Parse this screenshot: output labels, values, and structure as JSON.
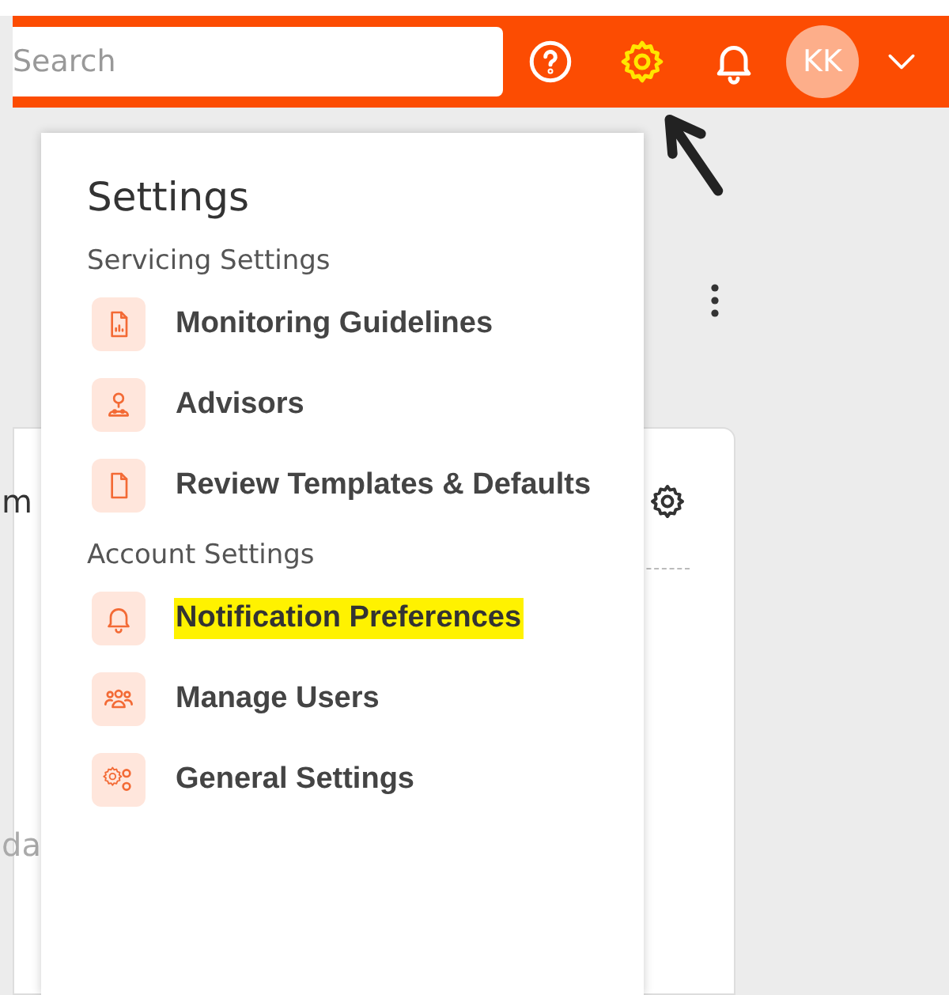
{
  "header": {
    "search": {
      "placeholder": "Search"
    },
    "icons": [
      {
        "kind": "help",
        "highlighted": false
      },
      {
        "kind": "settings",
        "highlighted": true
      },
      {
        "kind": "bell",
        "highlighted": false
      }
    ],
    "avatar": {
      "initials": "KK"
    }
  },
  "card": {
    "text_1": "m",
    "text_2": "da"
  },
  "settings_menu": {
    "title": "Settings",
    "sections": [
      {
        "title": "Servicing Settings",
        "items": [
          {
            "label": "Monitoring Guidelines",
            "kind": "chart-doc",
            "highlighted": false
          },
          {
            "label": "Advisors",
            "kind": "person",
            "highlighted": false
          },
          {
            "label": "Review Templates & Defaults",
            "kind": "doc",
            "highlighted": false
          }
        ]
      },
      {
        "title": "Account Settings",
        "items": [
          {
            "label": "Notification Preferences",
            "kind": "bell",
            "highlighted": true
          },
          {
            "label": "Manage Users",
            "kind": "users",
            "highlighted": false
          },
          {
            "label": "General Settings",
            "kind": "gears",
            "highlighted": false
          }
        ]
      }
    ]
  }
}
